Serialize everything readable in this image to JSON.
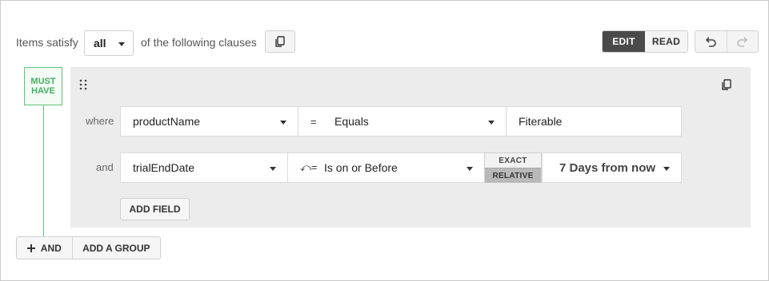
{
  "header": {
    "items_satisfy": "Items satisfy",
    "match_select": "all",
    "following_clauses": "of the following clauses"
  },
  "mode": {
    "edit": "EDIT",
    "read": "READ",
    "active": "EDIT"
  },
  "group": {
    "badge_line1": "MUST",
    "badge_line2": "HAVE",
    "clauses": [
      {
        "connector": "where",
        "field": "productName",
        "operator_symbol": "=",
        "operator": "Equals",
        "value": "Fiterable"
      },
      {
        "connector": "and",
        "field": "trialEndDate",
        "operator_symbol": "⤺=",
        "operator": "Is on or Before",
        "toggle_exact": "EXACT",
        "toggle_relative": "RELATIVE",
        "toggle_selected": "RELATIVE",
        "value": "7 Days from now"
      }
    ],
    "add_field": "ADD FIELD"
  },
  "footer": {
    "and": "AND",
    "add_group": "ADD A GROUP"
  },
  "colors": {
    "accent_green": "#5ec379",
    "active_mode": "#4a4a4a",
    "panel_bg": "#ececec"
  },
  "icons": [
    "copy-icon",
    "undo-icon",
    "redo-icon",
    "drag-handle-icon",
    "chevron-down-icon",
    "plus-icon"
  ]
}
